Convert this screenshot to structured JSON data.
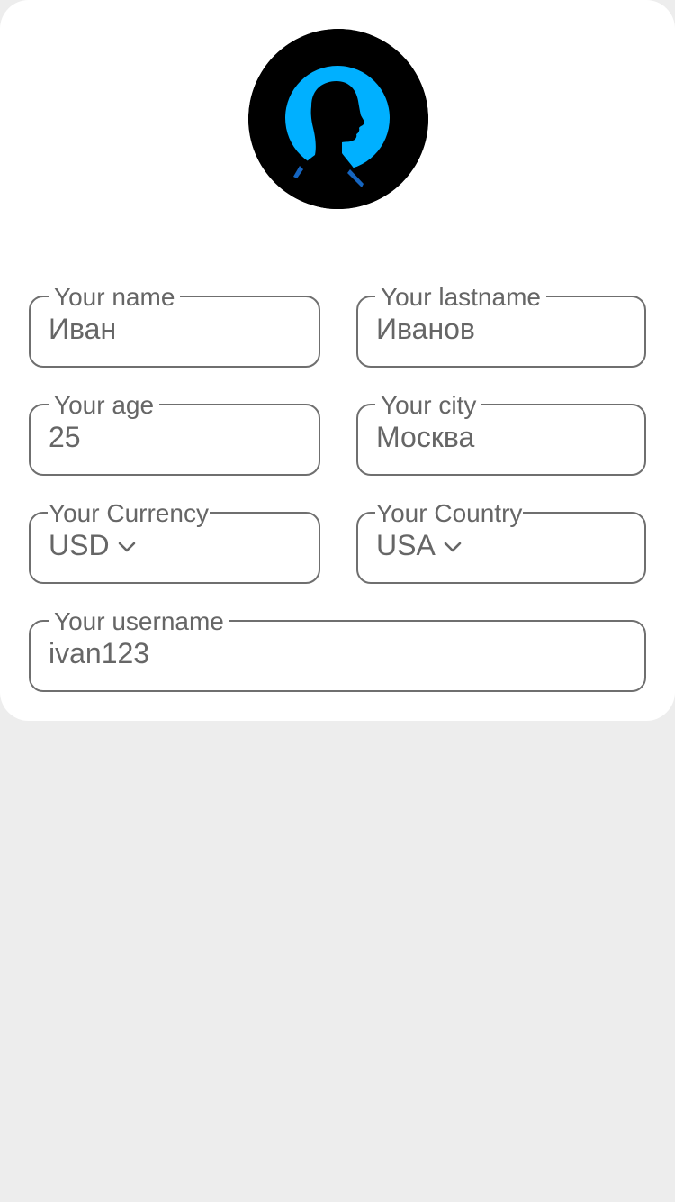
{
  "profile": {
    "avatar_icon": "person-silhouette-icon",
    "colors": {
      "avatar_bg": "#000000",
      "avatar_accent": "#00b0ff",
      "card_bg": "#ffffff",
      "page_bg": "#ededed",
      "field_border": "#6f6f6f",
      "text": "#666666"
    }
  },
  "form": {
    "name": {
      "label": "Your name",
      "value": "Иван"
    },
    "lastname": {
      "label": "Your lastname",
      "value": "Иванов"
    },
    "age": {
      "label": "Your age",
      "value": "25"
    },
    "city": {
      "label": "Your city",
      "value": "Москва"
    },
    "currency": {
      "label": "Your Currency",
      "value": "USD",
      "icon": "chevron-down-icon"
    },
    "country": {
      "label": "Your Country",
      "value": "USA",
      "icon": "chevron-down-icon"
    },
    "username": {
      "label": "Your username",
      "value": "ivan123"
    }
  }
}
